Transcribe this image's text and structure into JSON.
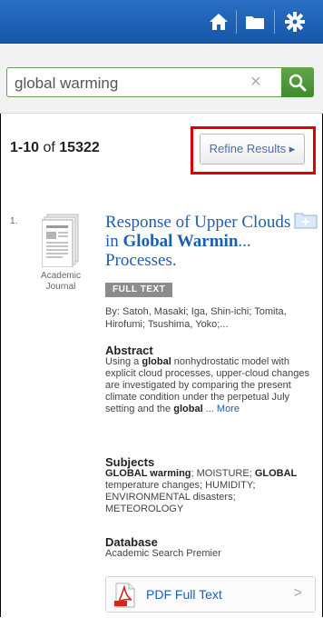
{
  "header": {
    "icons": [
      "home-icon",
      "folder-icon",
      "gear-icon"
    ]
  },
  "search": {
    "value": "global warming",
    "clear_icon": "×"
  },
  "results": {
    "range": "1-10",
    "of": "of",
    "total": "15322",
    "refine_label": "Refine Results ▸"
  },
  "result1": {
    "number": "1.",
    "pub_type": "Academic Journal",
    "title_pre": "Response of Upper Clouds in ",
    "title_bold": "Global Warmin",
    "title_post": "... Processes.",
    "badge": "FULL TEXT",
    "authors": "By: Satoh, Masaki; Iga, Shin-ichi; Tomita, Hirofumi; Tsushima, Yoko;...",
    "abstract_label": "Abstract",
    "abstract_pre": "Using a ",
    "abstract_bold1": "global",
    "abstract_mid": " nonhydrostatic model with explicit cloud processes, upper-cloud changes are investigated by comparing the present climate condition under the perpetual July setting and the ",
    "abstract_bold2": "global",
    "abstract_post": " ... ",
    "abstract_more": "More",
    "subjects_label": "Subjects",
    "subjects_b1": "GLOBAL warming",
    "subjects_t1": "; MOISTURE; ",
    "subjects_b2": "GLOBAL",
    "subjects_t2": " temperature changes; HUMIDITY; ENVIRONMENTAL disasters; METEOROLOGY",
    "database_label": "Database",
    "database_value": "Academic Search Premier",
    "pdf_label": "PDF Full Text",
    "pdf_chevron": ">"
  }
}
